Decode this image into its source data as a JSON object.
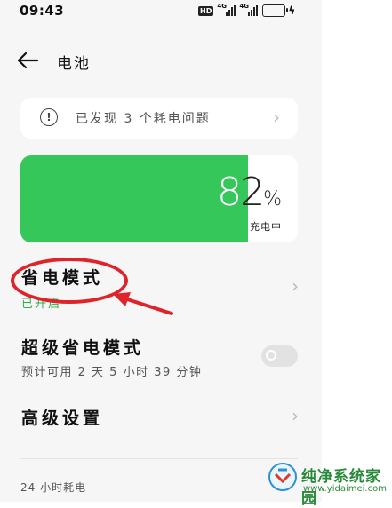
{
  "status_bar": {
    "time": "09:43",
    "hd_badge": "HD",
    "signal_1": "4G",
    "signal_2": "4G",
    "battery_level_pct": 82,
    "battery_color": "#f4c21f"
  },
  "header": {
    "back_icon": "arrow-left-icon",
    "title": "电池"
  },
  "alert": {
    "icon": "exclamation-circle-icon",
    "text": "已发现 3 个耗电问题"
  },
  "battery": {
    "percent_prefix": "8",
    "percent_suffix": "2",
    "percent_sign": "%",
    "percent_value": 82,
    "status": "充电中",
    "fill_color": "#35c759"
  },
  "power_saving": {
    "title": "省电模式",
    "status": "已开启",
    "status_color": "#2fae4e"
  },
  "super_saving": {
    "title": "超级省电模式",
    "subtitle": "预计可用 2 天 5 小时 39 分钟",
    "enabled": false
  },
  "advanced": {
    "title": "高级设置"
  },
  "usage": {
    "label": "24 小时耗电"
  },
  "annotation": {
    "color": "#e0232a"
  },
  "watermark": {
    "title": "纯净系统家园",
    "url": "www.yidaimei.com"
  }
}
